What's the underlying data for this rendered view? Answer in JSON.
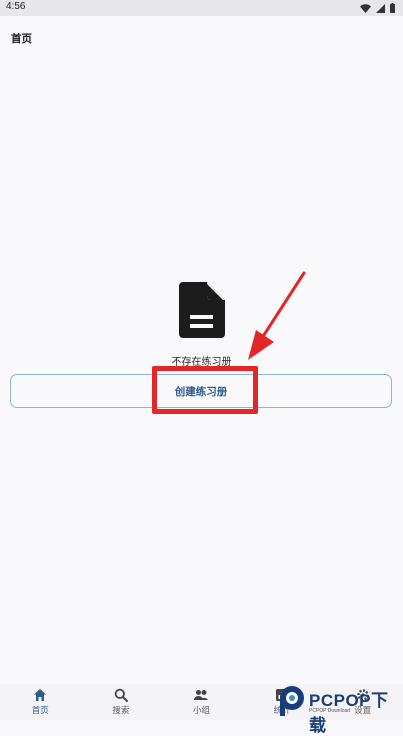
{
  "status_bar": {
    "time": "4:56",
    "icons": [
      "wifi-icon",
      "signal-icon",
      "battery-icon"
    ]
  },
  "header": {
    "title": "首页"
  },
  "empty_state": {
    "icon": "document-icon",
    "message": "不存在练习册"
  },
  "create_button": {
    "label": "创建练习册"
  },
  "bottom_nav": {
    "items": [
      {
        "label": "首页",
        "icon": "home-icon",
        "active": true
      },
      {
        "label": "搜索",
        "icon": "search-icon",
        "active": false
      },
      {
        "label": "小组",
        "icon": "group-icon",
        "active": false
      },
      {
        "label": "统计",
        "icon": "stats-icon",
        "active": false
      },
      {
        "label": "设置",
        "icon": "settings-icon",
        "active": false
      }
    ]
  },
  "watermark": {
    "brand": "PCPOP下载",
    "tagline": "PCPOP Download"
  },
  "colors": {
    "accent": "#2f5c8f",
    "highlight": "#e3262a",
    "background": "#f9f9fb"
  }
}
